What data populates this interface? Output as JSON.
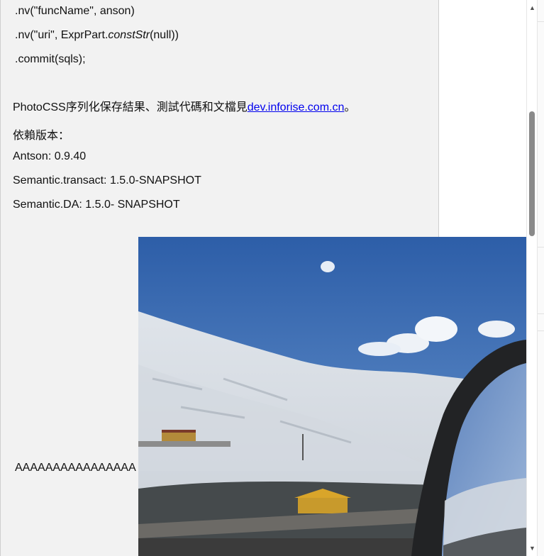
{
  "document": {
    "code_lines": [
      ".nv(\"funcName\", anson)",
      ".nv(\"uri\", ExprPart.",
      "constStr",
      "(null))",
      ".commit(sqls);"
    ],
    "result_prefix": "PhotoCSS序列化保存結果、測試代碼和文檔見",
    "result_link": "dev.inforise.com.cn",
    "result_suffix": "。",
    "deps_title": "依賴版本：",
    "deps": [
      "Antson: 0.9.40",
      "Semantic.transact: 1.5.0-SNAPSHOT",
      "Semantic.DA: 1.5.0- SNAPSHOT"
    ],
    "image_caption": "AAAAAAAAAAAAAAAA"
  },
  "scrollbar": {
    "up_arrow": "▲",
    "down_arrow": "▼",
    "thumb_fraction_start": 0.2,
    "thumb_fraction_visible": 0.22
  },
  "colors": {
    "panel": "#f2f2f2",
    "link": "#0000ee",
    "sky": "#3f6fb6"
  }
}
